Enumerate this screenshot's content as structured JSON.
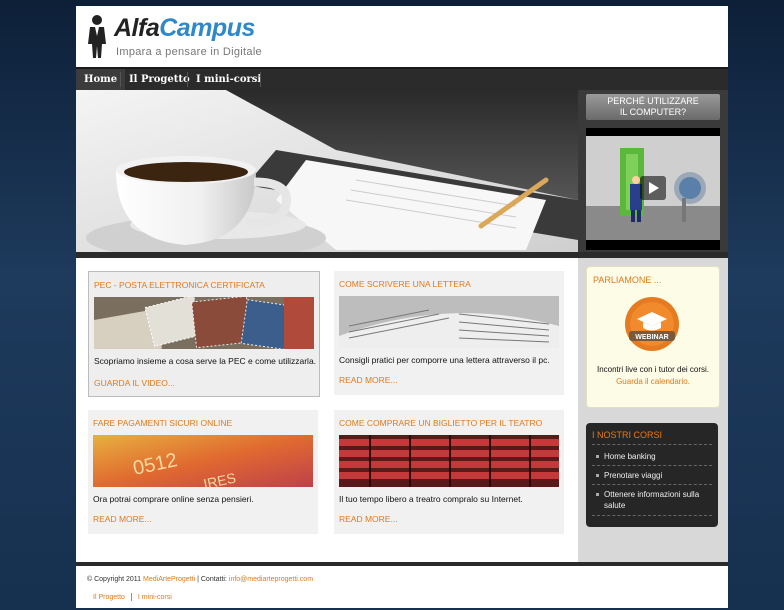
{
  "header": {
    "logo_part1": "Alfa",
    "logo_part2": "Campus",
    "tagline": "Impara a pensare in Digitale"
  },
  "nav": {
    "items": [
      {
        "label": "Home",
        "active": true
      },
      {
        "label": "Il Progetto",
        "active": false
      },
      {
        "label": "I mini-corsi",
        "active": false
      }
    ]
  },
  "side_video": {
    "title_line1": "PERCHÉ UTILIZZARE",
    "title_line2": "IL COMPUTER?"
  },
  "cards": [
    {
      "title": "PEC - POSTA ELETTRONICA CERTIFICATA",
      "desc": "Scopriamo insieme a cosa serve la PEC e come utilizzarla.",
      "link": "GUARDA IL VIDEO..."
    },
    {
      "title": "COME SCRIVERE UNA LETTERA",
      "desc": "Consigli pratici per comporre una lettera attraverso il pc.",
      "link": "READ MORE..."
    },
    {
      "title": "FARE PAGAMENTI SICURI ONLINE",
      "desc": "Ora potrai comprare online senza pensieri.",
      "link": "READ MORE..."
    },
    {
      "title": "COME COMPRARE UN BIGLIETTO PER IL TEATRO",
      "desc": "Il tuo tempo libero a treatro compralo su Internet.",
      "link": "READ MORE..."
    }
  ],
  "sidebar": {
    "parliamone_title": "PARLIAMONE ...",
    "webinar_label": "WEBINAR",
    "parliamone_text": "Incontri live con i tutor dei corsi.",
    "parliamone_link": "Guarda il calendario.",
    "corsi_title": "I NOSTRI CORSI",
    "corsi": [
      {
        "line1": "Home banking",
        "line2": ""
      },
      {
        "line1": "Prenotare viaggi",
        "line2": ""
      },
      {
        "line1": "Ottenere informazioni sulla",
        "line2": "salute"
      }
    ]
  },
  "footer": {
    "copyright": "© Copyright 2011",
    "company": "MediArteProgetti",
    "contacts_label": " | Contatti: ",
    "email": "info@mediarteprogetti.com",
    "links": [
      "Il Progetto",
      "I mini-corsi"
    ]
  },
  "colors": {
    "accent": "#e07a1e",
    "logo_blue": "#2f88c8",
    "nav_bg": "#2b2b2b"
  }
}
